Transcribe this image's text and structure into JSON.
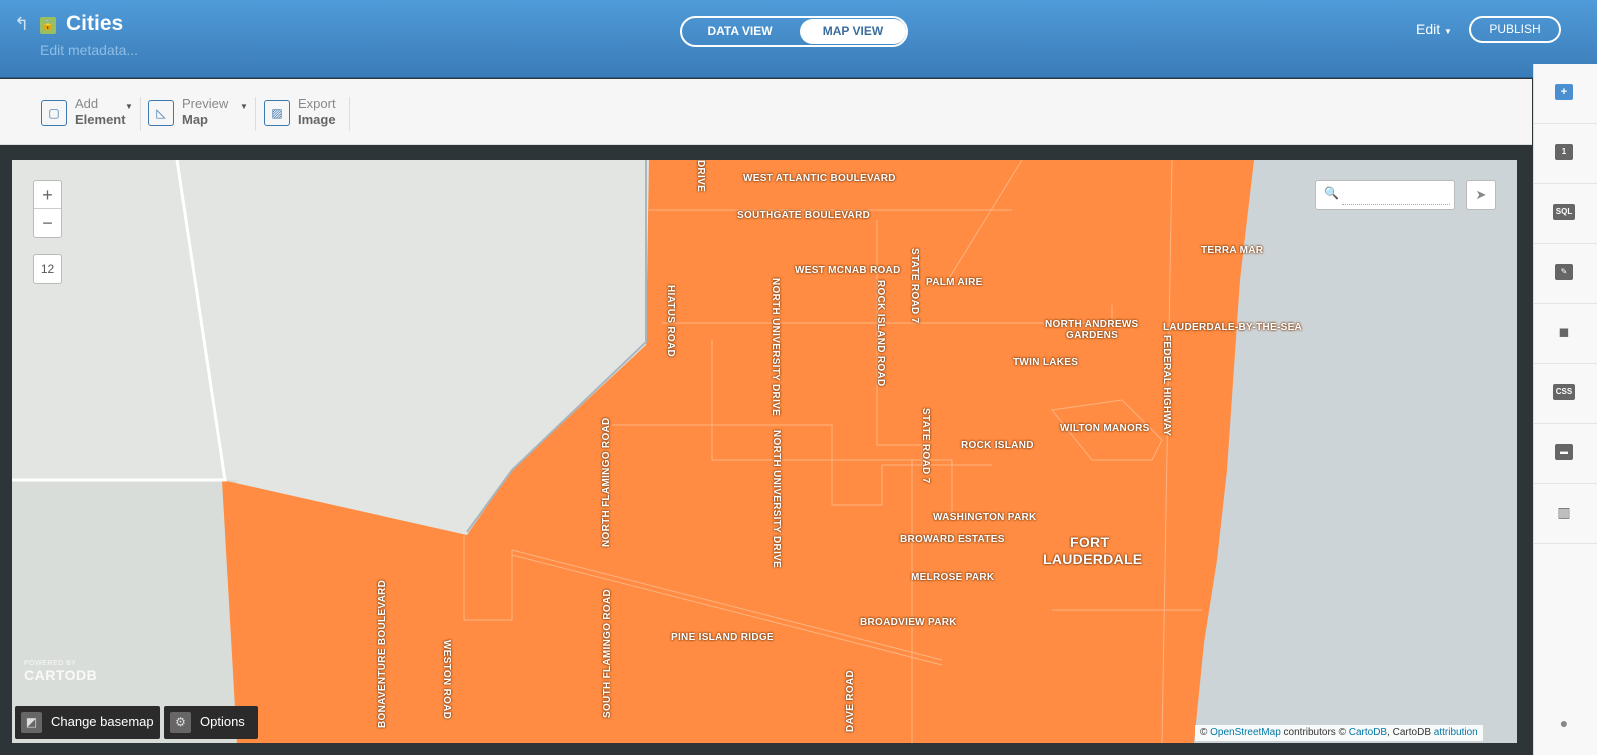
{
  "header": {
    "back_icon": "↰",
    "lock_icon": "lock-icon",
    "title": "Cities",
    "metadata_link": "Edit metadata...",
    "tabs": {
      "data_view": "DATA VIEW",
      "map_view": "MAP VIEW"
    },
    "edit_menu": "Edit",
    "publish": "PUBLISH"
  },
  "toolbar": {
    "add": {
      "line1": "Add",
      "line2": "Element"
    },
    "preview": {
      "line1": "Preview",
      "line2": "Map"
    },
    "export": {
      "line1": "Export",
      "line2": "Image"
    }
  },
  "right_sidebar": {
    "items": [
      {
        "icon": "add-icon",
        "label": "+"
      },
      {
        "icon": "layer-number-icon",
        "label": "1"
      },
      {
        "icon": "sql-icon",
        "label": "SQL"
      },
      {
        "icon": "wizard-brush-icon",
        "label": "✎"
      },
      {
        "icon": "infowindow-icon",
        "label": "💬"
      },
      {
        "icon": "css-icon",
        "label": "CSS"
      },
      {
        "icon": "legend-icon",
        "label": "▬"
      },
      {
        "icon": "filters-icon",
        "label": "||"
      },
      {
        "icon": "help-icon",
        "label": "?"
      }
    ]
  },
  "map": {
    "zoom_in": "+",
    "zoom_out": "−",
    "zoom_level": "12",
    "search_placeholder": "",
    "labels": {
      "west_atlantic_boulevard": "WEST ATLANTIC BOULEVARD",
      "southgate_boulevard": "SOUTHGATE BOULEVARD",
      "west_mcnab_road": "WEST MCNAB ROAD",
      "palm_aire": "PALM AIRE",
      "terra_mar": "TERRA MAR",
      "north_andrews_gardens_1": "NORTH ANDREWS",
      "north_andrews_gardens_2": "GARDENS",
      "lauderdale_by_the_sea": "LAUDERDALE-BY-THE-SEA",
      "twin_lakes": "TWIN LAKES",
      "federal_highway": "FEDERAL HIGHWAY",
      "wilton_manors": "WILTON MANORS",
      "rock_island": "ROCK ISLAND",
      "washington_park": "WASHINGTON PARK",
      "broward_estates": "BROWARD ESTATES",
      "fort_lauderdale_1": "FORT",
      "fort_lauderdale_2": "LAUDERDALE",
      "melrose_park": "MELROSE PARK",
      "broadview_park": "BROADVIEW PARK",
      "pine_island_ridge": "PINE ISLAND RIDGE",
      "hiatus_road": "HIATUS ROAD",
      "north_university_drive": "NORTH UNIVERSITY DRIVE",
      "rock_island_road": "ROCK ISLAND ROAD",
      "state_road_7": "STATE ROAD 7",
      "north_flamingo_road": "NORTH FLAMINGO ROAD",
      "south_flamingo_road": "SOUTH FLAMINGO ROAD",
      "weston_road": "WESTON ROAD",
      "bonaventure_boulevard": "BONAVENTURE BOULEVARD",
      "drive_top": "DRIVE",
      "dave_road": "DAVE ROAD"
    },
    "brand_powered": "POWERED BY",
    "brand_name": "CARTODB",
    "change_basemap": "Change basemap",
    "options": "Options",
    "attribution": {
      "prefix": "©",
      "osm": "OpenStreetMap",
      "mid": "contributors ©",
      "cartodb": "CartoDB",
      "tail": ", CartoDB",
      "attribution": "attribution"
    }
  },
  "colors": {
    "polygon_fill": "#ff8c42",
    "water": "#cdd4d8",
    "land": "#e2e5e1",
    "header": "#4a90d0"
  }
}
